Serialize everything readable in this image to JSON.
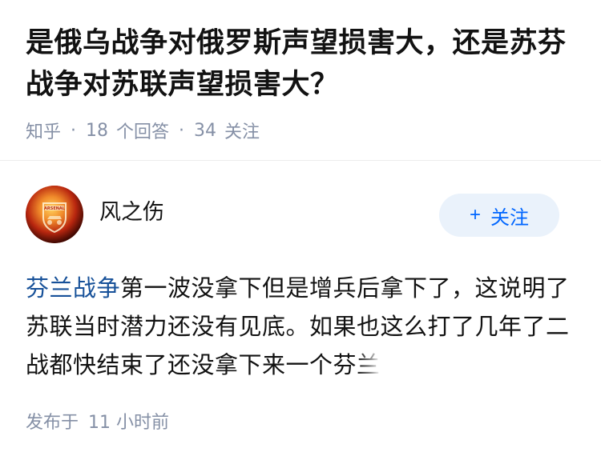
{
  "question": {
    "title_line1": "是俄乌战争对俄罗斯声望损害大，还是苏芬",
    "title_line2": "战争对苏联声望损害大？",
    "source": "知乎",
    "answer_count": "18",
    "answer_label": "个回答",
    "follow_count": "34",
    "follow_label": "关注",
    "separator": "·"
  },
  "author": {
    "name": "风之伤",
    "follow_button_plus": "+",
    "follow_button_label": "关注",
    "avatar_text": "ARSENAL"
  },
  "answer": {
    "link_text": "芬兰战争",
    "text_1": "第一波没拿下但是增兵后拿下了，这说明了苏联当时潜力还没有见底。如果也这么打了几年了二战都快结束了还没拿下来一个芬",
    "text_fade": "兰"
  },
  "footer": {
    "published_label": "发布于",
    "published_time": "11 小时前"
  },
  "colors": {
    "accent": "#0066ff",
    "link": "#175199",
    "meta": "#8590a6",
    "button_bg": "#eaf2fb"
  }
}
